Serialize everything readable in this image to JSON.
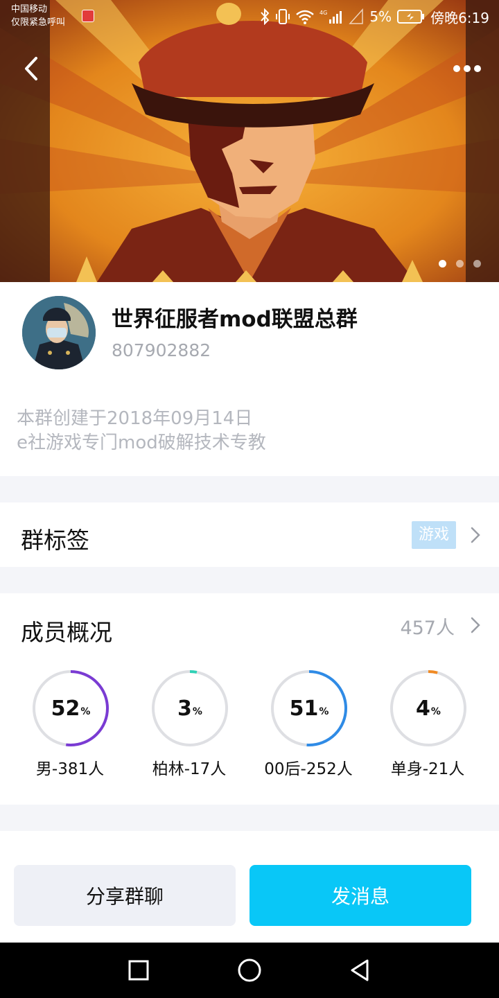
{
  "status_bar": {
    "carrier_line1": "中国移动",
    "carrier_line2": "仅限紧急呼叫",
    "battery": "5%",
    "time": "傍晚6:19",
    "network": "4G"
  },
  "hero": {
    "banner_image": "military-officer-poster",
    "back_icon": "chevron-left-icon",
    "more_icon": "more-dots-icon",
    "page_dots": 3,
    "active_dot": 0
  },
  "group": {
    "name": "世界征服者mod联盟总群",
    "id": "807902882",
    "desc_line1": "本群创建于2018年09月14日",
    "desc_line2": "e社游戏专门mod破解技术专教"
  },
  "tags": {
    "title": "群标签",
    "tag": "游戏"
  },
  "members": {
    "title": "成员概况",
    "count": "457人",
    "stats": [
      {
        "value": "52",
        "unit": "%",
        "label": "男-381人",
        "percent": 52,
        "color": "#7a3bd3"
      },
      {
        "value": "3",
        "unit": "%",
        "label": "柏林-17人",
        "percent": 3,
        "color": "#2fd1b6"
      },
      {
        "value": "51",
        "unit": "%",
        "label": "00后-252人",
        "percent": 51,
        "color": "#2f8be6"
      },
      {
        "value": "4",
        "unit": "%",
        "label": "单身-21人",
        "percent": 4,
        "color": "#f08a24"
      }
    ]
  },
  "actions": {
    "share": "分享群聊",
    "send": "发消息"
  },
  "colors": {
    "accent": "#09c7f7",
    "gap": "#f4f5f9",
    "muted_text": "#a6a9b0"
  }
}
